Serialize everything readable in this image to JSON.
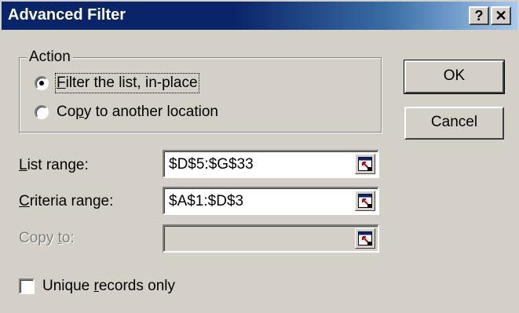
{
  "window": {
    "title": "Advanced Filter",
    "help_button": "?",
    "close_button": "✕"
  },
  "action_group": {
    "legend": "Action",
    "options": [
      {
        "label_pre": "",
        "label_key": "F",
        "label_post": "ilter the list, in-place",
        "checked": true
      },
      {
        "label_pre": "Co",
        "label_key": "p",
        "label_post": "y to another location",
        "checked": false
      }
    ]
  },
  "buttons": {
    "ok_label": "OK",
    "cancel_label": "Cancel"
  },
  "fields": {
    "list_range": {
      "label_pre": "",
      "label_key": "L",
      "label_post": "ist range:",
      "value": "$D$5:$G$33",
      "enabled": true
    },
    "criteria_range": {
      "label_pre": "",
      "label_key": "C",
      "label_post": "riteria range:",
      "value": "$A$1:$D$3",
      "enabled": true
    },
    "copy_to": {
      "label_pre": "Copy ",
      "label_key": "t",
      "label_post": "o:",
      "value": "",
      "enabled": false
    }
  },
  "unique_records": {
    "label_pre": "Unique ",
    "label_key": "r",
    "label_post": "ecords only",
    "checked": false
  },
  "colors": {
    "title_bar": "#0a246a",
    "face": "#d4d0c8",
    "collapse_icon_accent": "#cc0000"
  },
  "icons": {
    "collapse_dialog": "collapse-dialog-icon"
  }
}
